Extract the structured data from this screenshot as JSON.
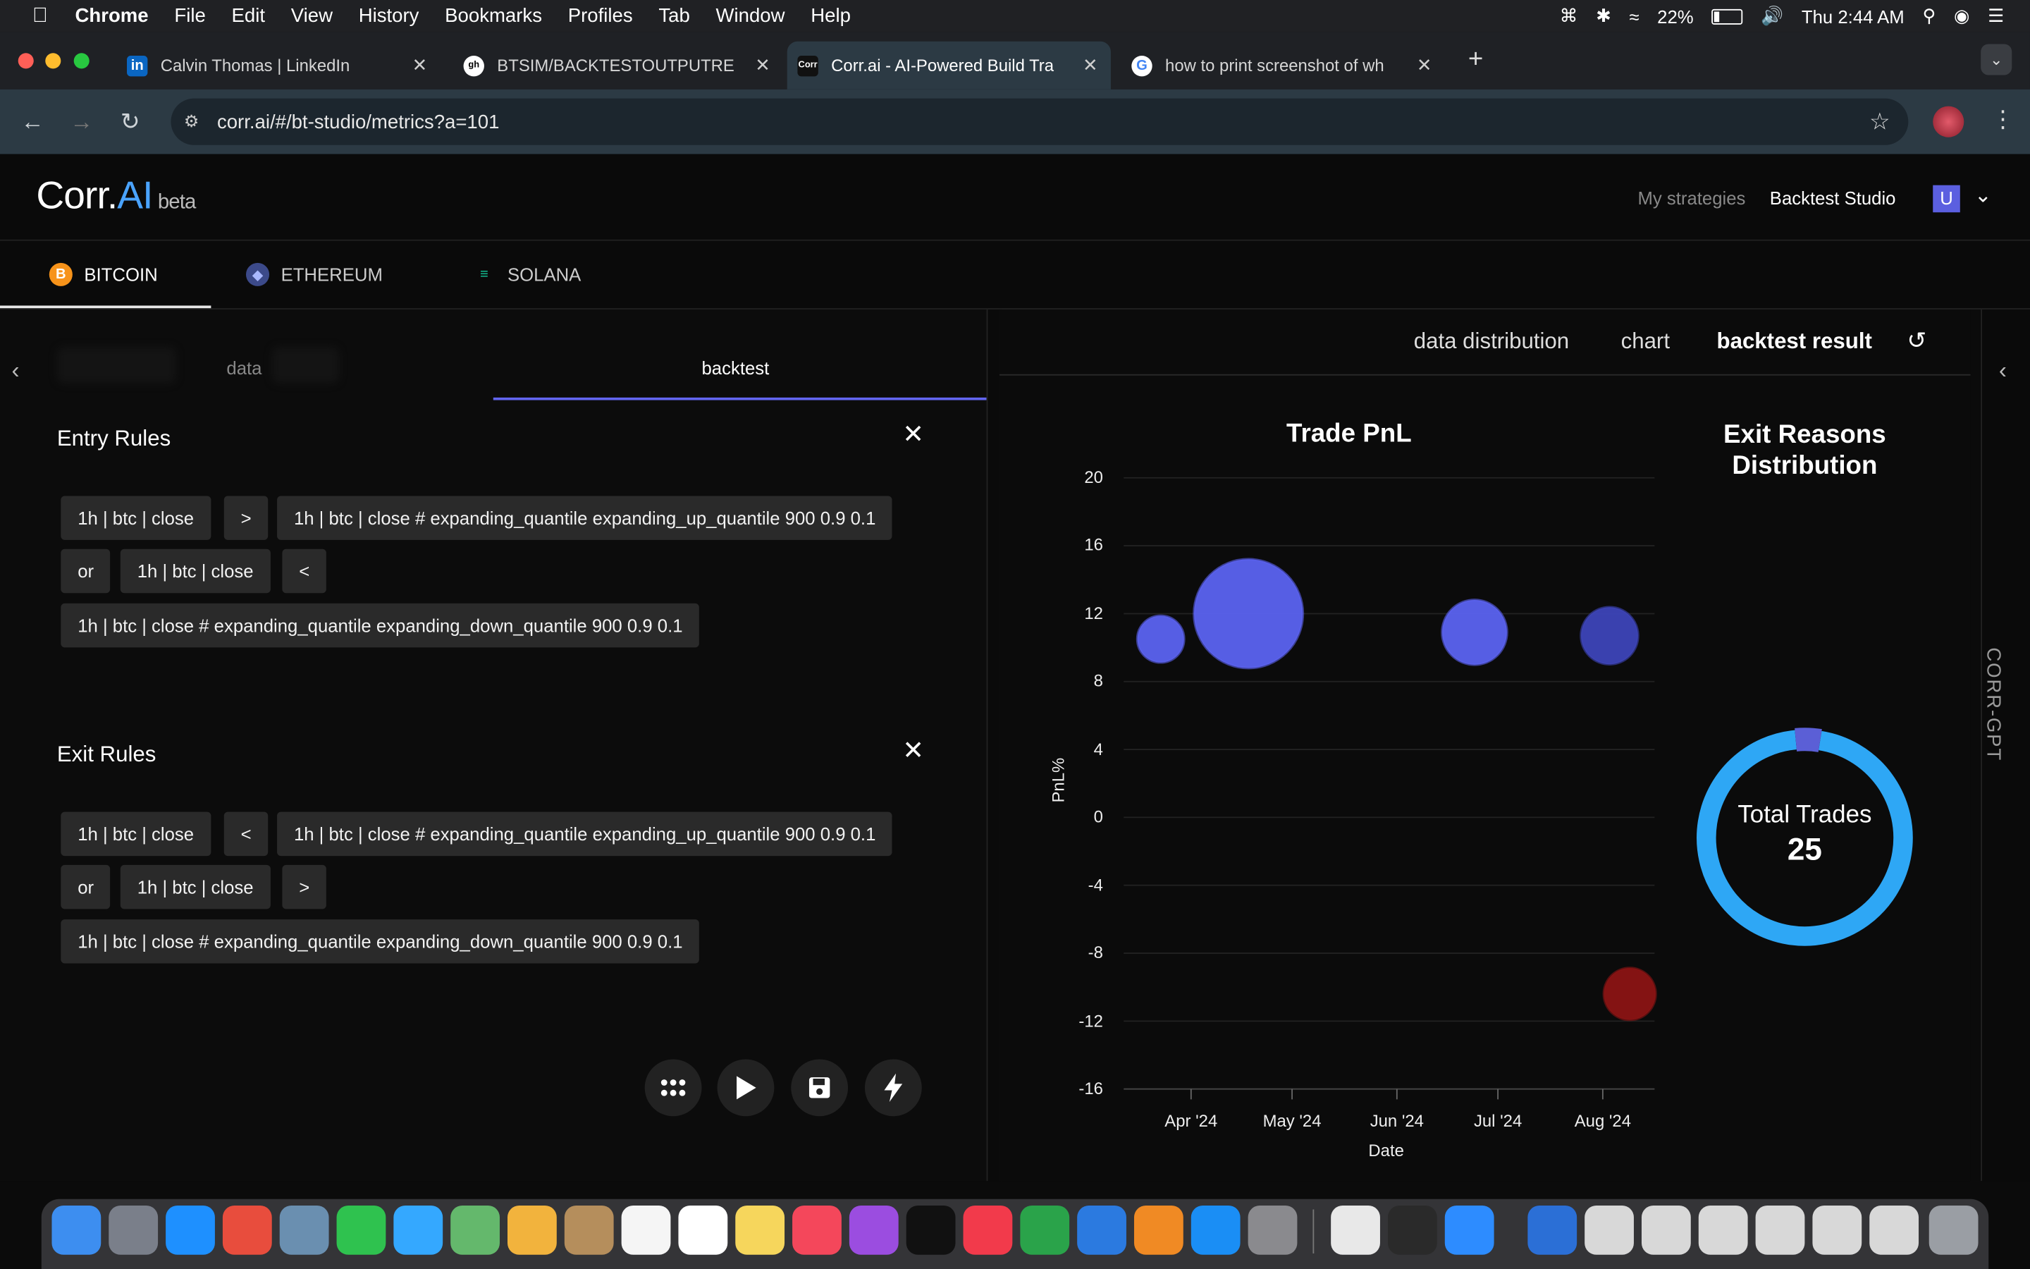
{
  "menubar": {
    "app": "Chrome",
    "items": [
      "File",
      "Edit",
      "View",
      "History",
      "Bookmarks",
      "Profiles",
      "Tab",
      "Window",
      "Help"
    ],
    "battery": "22%",
    "clock": "Thu 2:44 AM"
  },
  "tabs": [
    {
      "favicon": "in",
      "title": "Calvin Thomas | LinkedIn"
    },
    {
      "favicon": "gh",
      "title": "BTSIM/BACKTESTOUTPUTRE"
    },
    {
      "favicon": "Corr",
      "title": "Corr.ai - AI-Powered Build Tra"
    },
    {
      "favicon": "G",
      "title": "how to print screenshot of wh"
    }
  ],
  "address": {
    "url": "corr.ai/#/bt-studio/metrics?a=101"
  },
  "app": {
    "logo_main": "Corr.",
    "logo_ai": "AI",
    "logo_beta": "beta",
    "nav": {
      "my_strategies": "My strategies",
      "backtest_studio": "Backtest Studio",
      "avatar": "U"
    }
  },
  "coins": [
    {
      "label": "BITCOIN",
      "color": "#f7931a",
      "glyph": "B"
    },
    {
      "label": "ETHEREUM",
      "color": "#627eea",
      "glyph": "◆"
    },
    {
      "label": "SOLANA",
      "color": "#14f195",
      "glyph": "≡"
    }
  ],
  "left": {
    "subtabs": {
      "data": "data",
      "backtest": "backtest"
    },
    "entry": {
      "title": "Entry Rules",
      "chips": [
        "1h | btc | close",
        ">",
        "1h | btc | close # expanding_quantile expanding_up_quantile 900 0.9 0.1",
        "or",
        "1h | btc | close",
        "<",
        "1h | btc | close # expanding_quantile expanding_down_quantile 900 0.9 0.1"
      ]
    },
    "exit": {
      "title": "Exit Rules",
      "chips": [
        "1h | btc | close",
        "<",
        "1h | btc | close # expanding_quantile expanding_up_quantile 900 0.9 0.1",
        "or",
        "1h | btc | close",
        ">",
        "1h | btc | close # expanding_quantile expanding_down_quantile 900 0.9 0.1"
      ]
    }
  },
  "right": {
    "tabs": {
      "dist": "data distribution",
      "chart": "chart",
      "result": "backtest result"
    },
    "side_label": "CORR-GPT",
    "exit_reasons": {
      "title_line1": "Exit Reasons",
      "title_line2": "Distribution",
      "center_label": "Total Trades",
      "center_value": "25"
    }
  },
  "chart_data": {
    "type": "scatter",
    "title": "Trade PnL",
    "xlabel": "Date",
    "ylabel": "PnL%",
    "ylim": [
      -16,
      20
    ],
    "yticks": [
      20,
      16,
      12,
      8,
      4,
      0,
      -4,
      -8,
      -12,
      -16
    ],
    "xticks": [
      "Apr '24",
      "May '24",
      "Jun '24",
      "Jul '24",
      "Aug '24"
    ],
    "points": [
      {
        "date": "2024-03-23",
        "pnl": 10.5,
        "size": 18,
        "color": "#5b63f0"
      },
      {
        "date": "2024-04-18",
        "pnl": 12.0,
        "size": 42,
        "color": "#5b63f0"
      },
      {
        "date": "2024-06-24",
        "pnl": 10.9,
        "size": 25,
        "color": "#5b63f0"
      },
      {
        "date": "2024-08-03",
        "pnl": 10.7,
        "size": 22,
        "color": "#3d45b8"
      },
      {
        "date": "2024-08-09",
        "pnl": -10.4,
        "size": 20,
        "color": "#8b1414"
      }
    ],
    "donut": {
      "total": 25,
      "segments": [
        {
          "value": 24,
          "color": "#2ea7f5"
        },
        {
          "value": 1,
          "color": "#5b5fd6"
        }
      ]
    }
  }
}
